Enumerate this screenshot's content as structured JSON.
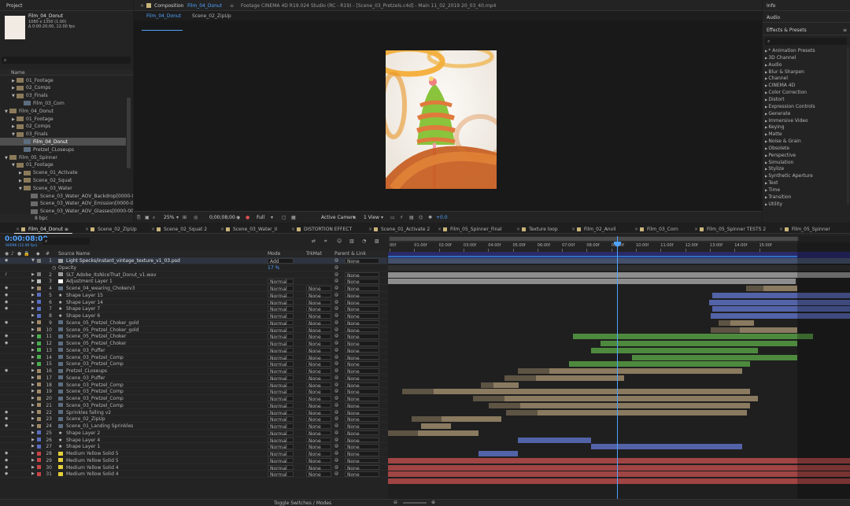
{
  "project": {
    "title": "Project",
    "comp_name": "Film_04_Donut",
    "comp_info_1": "1080 x 1350 (1.00)",
    "comp_info_2": "Δ 0:00:20:00, 12.00 fps",
    "column_name": "Name",
    "footer_bpc": "8 bpc",
    "items": [
      {
        "label": "01_Footage",
        "indent": 1,
        "type": "folder",
        "twirl": "▶"
      },
      {
        "label": "02_Comps",
        "indent": 1,
        "type": "folder",
        "twirl": "▶"
      },
      {
        "label": "03_Finals",
        "indent": 1,
        "type": "folder",
        "twirl": "▼"
      },
      {
        "label": "Film_03_Corn",
        "indent": 2,
        "type": "comp",
        "twirl": ""
      },
      {
        "label": "Film_04_Donut",
        "indent": 0,
        "type": "folder",
        "twirl": "▼"
      },
      {
        "label": "01_Footage",
        "indent": 1,
        "type": "folder",
        "twirl": "▶"
      },
      {
        "label": "02_Comps",
        "indent": 1,
        "type": "folder",
        "twirl": "▶"
      },
      {
        "label": "03_Finals",
        "indent": 1,
        "type": "folder",
        "twirl": "▼"
      },
      {
        "label": "Film_04_Donut",
        "indent": 2,
        "type": "comp",
        "twirl": "",
        "selected": true
      },
      {
        "label": "Pretzel_CLoseups",
        "indent": 2,
        "type": "comp",
        "twirl": ""
      },
      {
        "label": "Film_05_Spinner",
        "indent": 0,
        "type": "folder",
        "twirl": "▼"
      },
      {
        "label": "01_Footage",
        "indent": 1,
        "type": "folder",
        "twirl": "▼"
      },
      {
        "label": "Scene_01_Activate",
        "indent": 2,
        "type": "folder",
        "twirl": "▶"
      },
      {
        "label": "Scene_02_Squat",
        "indent": 2,
        "type": "folder",
        "twirl": "▶"
      },
      {
        "label": "Scene_03_Water",
        "indent": 2,
        "type": "folder",
        "twirl": "▼"
      },
      {
        "label": "Scene_03_Water_AOV_Backdrop[0000-00",
        "indent": 3,
        "type": "footage",
        "twirl": ""
      },
      {
        "label": "Scene_03_Water_AOV_Emission[0000-00",
        "indent": 3,
        "type": "footage",
        "twirl": ""
      },
      {
        "label": "Scene_03_Water_AOV_Glasses[0000-006",
        "indent": 3,
        "type": "footage",
        "twirl": ""
      }
    ]
  },
  "viewer": {
    "comp_tab_prefix": "Composition",
    "comp_tab_name": "Film_04_Donut",
    "footage_tab": "Footage  CINEMA 4D R19.024 Studio (RC - R19) - [Scene_03_Pretzels.c4d] - Main 11_02_2019 20_03_40.mp4",
    "subtabs": [
      "Film_04_Donut",
      "Scene_02_ZipUp"
    ],
    "zoom": "25%",
    "timecode": "0;00;08;00",
    "resolution": "Full",
    "camera": "Active Camera",
    "views": "1 View",
    "exposure": "+0.0"
  },
  "right_panel": {
    "info": "Info",
    "audio": "Audio",
    "effects_title": "Effects & Presets",
    "effects": [
      "* Animation Presets",
      "3D Channel",
      "Audio",
      "Blur & Sharpen",
      "Channel",
      "CINEMA 4D",
      "Color Correction",
      "Distort",
      "Expression Controls",
      "Generate",
      "Immersive Video",
      "Keying",
      "Matte",
      "Noise & Grain",
      "Obsolete",
      "Perspective",
      "Simulation",
      "Stylize",
      "Synthetic Aperture",
      "Text",
      "Time",
      "Transition",
      "Utility"
    ]
  },
  "timeline": {
    "tabs": [
      {
        "label": "Film_04_Donut",
        "color": "#c9b47a",
        "active": true
      },
      {
        "label": "Scene_02_ZipUp",
        "color": "#c9b47a"
      },
      {
        "label": "Scene_02_Squat 2",
        "color": "#c9b47a"
      },
      {
        "label": "Scene_03_Water_II",
        "color": "#c9b47a"
      },
      {
        "label": "DISTORTION EFFECT",
        "color": "#c9b47a"
      },
      {
        "label": "Scene_01_Activate 2",
        "color": "#c9b47a"
      },
      {
        "label": "Film_05_Spinner_Final",
        "color": "#c9b47a"
      },
      {
        "label": "Texture loop",
        "color": "#c9b47a"
      },
      {
        "label": "Film_02_Anvil",
        "color": "#c9b47a"
      },
      {
        "label": "Film_03_Corn",
        "color": "#c9b47a"
      },
      {
        "label": "Film_05_Spinner TESTS 2",
        "color": "#c9b47a"
      },
      {
        "label": "Film_05_Spinner",
        "color": "#c9b47a"
      }
    ],
    "timecode": "0:00:08:00",
    "fps_label": "00096 (12.00 fps)",
    "col_source": "Source Name",
    "col_mode": "Mode",
    "col_trkmat": "TrkMat",
    "col_parent": "Parent & Link",
    "ruler": [
      "00f",
      "01:00f",
      "02:00f",
      "03:00f",
      "04:00f",
      "05:00f",
      "06:00f",
      "07:00f",
      "08:00f",
      "09:00f",
      "10:00f",
      "11:00f",
      "12:00f",
      "13:00f",
      "14:00f",
      "15:00f"
    ],
    "footer": "Toggle Switches / Modes",
    "opacity_label": "Opacity",
    "opacity_value": "17 %",
    "layers": [
      {
        "num": "1",
        "name": "Light Specks/instant_vintage_texture_v1_03.psd",
        "mode": "Add",
        "trk": "",
        "parent": "None",
        "label": "#7f7f7f",
        "twirl": "▼",
        "ico": "#9e9e9e"
      },
      {
        "num": "2",
        "name": "SLT_Adobe_ItsNiceThat_Donut_v1.wav",
        "mode": "",
        "trk": "",
        "parent": "None",
        "label": "#7f7f7f",
        "twirl": "▶",
        "ico": "#9e9e9e"
      },
      {
        "num": "3",
        "name": "Adjustment Layer 1",
        "mode": "Normal",
        "trk": "",
        "parent": "None",
        "label": "#bfbfbf",
        "twirl": "▶",
        "ico": "#ffffff"
      },
      {
        "num": "4",
        "name": "Scene_04_wearing_Chokerv3",
        "mode": "Normal",
        "trk": "None",
        "parent": "None",
        "label": "#a08a6a",
        "twirl": "▶",
        "ico": "#5c6d80"
      },
      {
        "num": "5",
        "name": "Shape Layer 15",
        "mode": "Normal",
        "trk": "None",
        "parent": "None",
        "label": "#5a6fbf",
        "twirl": "▶",
        "ico": "star"
      },
      {
        "num": "6",
        "name": "Shape Layer 14",
        "mode": "Normal",
        "trk": "None",
        "parent": "None",
        "label": "#5a6fbf",
        "twirl": "▶",
        "ico": "star"
      },
      {
        "num": "7",
        "name": "Shape Layer 7",
        "mode": "Normal",
        "trk": "None",
        "parent": "None",
        "label": "#5a6fbf",
        "twirl": "▶",
        "ico": "star"
      },
      {
        "num": "8",
        "name": "Shape Layer 6",
        "mode": "Normal",
        "trk": "None",
        "parent": "None",
        "label": "#5a6fbf",
        "twirl": "▶",
        "ico": "star"
      },
      {
        "num": "9",
        "name": "Scene_05_Pretzel_Choker_gold",
        "mode": "Normal",
        "trk": "None",
        "parent": "None",
        "label": "#a08a6a",
        "twirl": "▶",
        "ico": "#5c6d80"
      },
      {
        "num": "10",
        "name": "Scene_05_Pretzel_Choker_gold",
        "mode": "Normal",
        "trk": "None",
        "parent": "None",
        "label": "#a08a6a",
        "twirl": "▶",
        "ico": "#5c6d80"
      },
      {
        "num": "11",
        "name": "Scene_05_Pretzel_Choker",
        "mode": "Normal",
        "trk": "None",
        "parent": "None",
        "label": "#4caf50",
        "twirl": "▶",
        "ico": "#5c6d80"
      },
      {
        "num": "12",
        "name": "Scene_05_Pretzel_Choker",
        "mode": "Normal",
        "trk": "None",
        "parent": "None",
        "label": "#4caf50",
        "twirl": "▶",
        "ico": "#5c6d80"
      },
      {
        "num": "13",
        "name": "Scene_03_Puffer",
        "mode": "Normal",
        "trk": "None",
        "parent": "None",
        "label": "#4caf50",
        "twirl": "▶",
        "ico": "#5c6d80"
      },
      {
        "num": "14",
        "name": "Scene_03_Pretzel_Comp",
        "mode": "Normal",
        "trk": "None",
        "parent": "None",
        "label": "#4caf50",
        "twirl": "▶",
        "ico": "#5c6d80"
      },
      {
        "num": "15",
        "name": "Scene_03_Pretzel_Comp",
        "mode": "Normal",
        "trk": "None",
        "parent": "None",
        "label": "#4caf50",
        "twirl": "▶",
        "ico": "#5c6d80"
      },
      {
        "num": "16",
        "name": "Pretzel_CLoseups",
        "mode": "Normal",
        "trk": "None",
        "parent": "None",
        "label": "#a08a6a",
        "twirl": "▶",
        "ico": "#5c6d80"
      },
      {
        "num": "17",
        "name": "Scene_03_Puffer",
        "mode": "Normal",
        "trk": "None",
        "parent": "None",
        "label": "#a08a6a",
        "twirl": "▶",
        "ico": "#5c6d80"
      },
      {
        "num": "18",
        "name": "Scene_03_Pretzel_Comp",
        "mode": "Normal",
        "trk": "None",
        "parent": "None",
        "label": "#a08a6a",
        "twirl": "▶",
        "ico": "#5c6d80"
      },
      {
        "num": "19",
        "name": "Scene_03_Pretzel_Comp",
        "mode": "Normal",
        "trk": "None",
        "parent": "None",
        "label": "#a08a6a",
        "twirl": "▶",
        "ico": "#5c6d80"
      },
      {
        "num": "20",
        "name": "Scene_03_Pretzel_Comp",
        "mode": "Normal",
        "trk": "None",
        "parent": "None",
        "label": "#a08a6a",
        "twirl": "▶",
        "ico": "#5c6d80"
      },
      {
        "num": "21",
        "name": "Scene_03_Pretzel_Comp",
        "mode": "Normal",
        "trk": "None",
        "parent": "None",
        "label": "#a08a6a",
        "twirl": "▶",
        "ico": "#5c6d80"
      },
      {
        "num": "22",
        "name": "Sprinkles falling v2",
        "mode": "Normal",
        "trk": "None",
        "parent": "None",
        "label": "#a08a6a",
        "twirl": "▶",
        "ico": "#5c6d80"
      },
      {
        "num": "23",
        "name": "Scene_02_ZipUp",
        "mode": "Normal",
        "trk": "None",
        "parent": "None",
        "label": "#a08a6a",
        "twirl": "▶",
        "ico": "#5c6d80"
      },
      {
        "num": "24",
        "name": "Scene_01_Landing Sprinkles",
        "mode": "Normal",
        "trk": "None",
        "parent": "None",
        "label": "#a08a6a",
        "twirl": "▶",
        "ico": "#5c6d80"
      },
      {
        "num": "25",
        "name": "Shape Layer 2",
        "mode": "Normal",
        "trk": "None",
        "parent": "None",
        "label": "#5a6fbf",
        "twirl": "▶",
        "ico": "star"
      },
      {
        "num": "26",
        "name": "Shape Layer 4",
        "mode": "Normal",
        "trk": "None",
        "parent": "None",
        "label": "#5a6fbf",
        "twirl": "▶",
        "ico": "star"
      },
      {
        "num": "27",
        "name": "Shape Layer 1",
        "mode": "Normal",
        "trk": "None",
        "parent": "None",
        "label": "#5a6fbf",
        "twirl": "▶",
        "ico": "star"
      },
      {
        "num": "28",
        "name": "Medium Yellow Solid 5",
        "mode": "Normal",
        "trk": "None",
        "parent": "None",
        "label": "#c74646",
        "twirl": "▶",
        "ico": "#e6d13a"
      },
      {
        "num": "29",
        "name": "Medium Yellow Solid 5",
        "mode": "Normal",
        "trk": "None",
        "parent": "None",
        "label": "#c74646",
        "twirl": "▶",
        "ico": "#e6d13a"
      },
      {
        "num": "30",
        "name": "Medium Yellow Solid 4",
        "mode": "Normal",
        "trk": "None",
        "parent": "None",
        "label": "#c74646",
        "twirl": "▶",
        "ico": "#e6d13a"
      },
      {
        "num": "31",
        "name": "Medium Yellow Solid 4",
        "mode": "Normal",
        "trk": "None",
        "parent": "None",
        "label": "#c74646",
        "twirl": "▶",
        "ico": "#e6d13a"
      }
    ]
  }
}
